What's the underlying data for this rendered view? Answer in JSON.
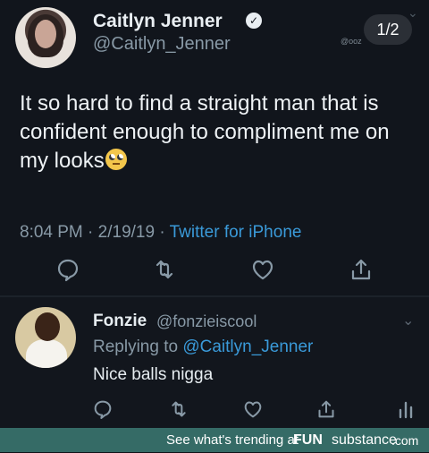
{
  "main_tweet": {
    "display_name": "Caitlyn Jenner",
    "handle": "@Caitlyn_Jenner",
    "watermark": "@ooz",
    "page_counter": "1/2",
    "text": "It so hard to find a straight man that is confident enough to compliment me on my looks",
    "time": "8:04 PM",
    "separator": " · ",
    "date": "2/19/19",
    "source": "Twitter for iPhone",
    "actions": [
      "reply-icon",
      "retweet-icon",
      "like-icon",
      "share-icon"
    ],
    "emoji": "face-with-rolling-eyes-icon"
  },
  "reply_tweet": {
    "display_name": "Fonzie",
    "handle": "@fonzieiscool",
    "replying_label": "Replying to",
    "replying_handle": "@Caitlyn_Jenner",
    "text": "Nice balls nigga",
    "actions": [
      "reply-icon",
      "retweet-icon",
      "like-icon",
      "share-icon",
      "analytics-icon"
    ]
  },
  "footer": {
    "text": "See what's trending at",
    "brand_part1": "FUN",
    "brand_part2": "substance",
    "brand_tld": ".com"
  },
  "colors": {
    "background": "#11151c",
    "link": "#3a9ad9",
    "secondary_text": "#8899a6",
    "footer_bg": "#356b66"
  }
}
